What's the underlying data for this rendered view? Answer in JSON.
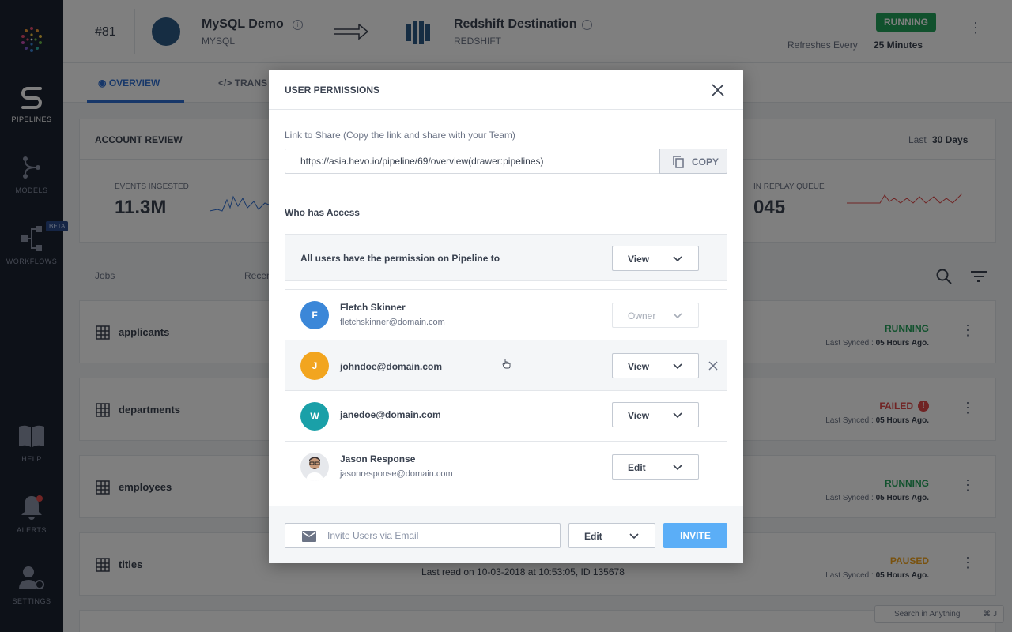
{
  "sidebar": {
    "items": [
      {
        "label": "PIPELINES"
      },
      {
        "label": "MODELS"
      },
      {
        "label": "WORKFLOWS"
      },
      {
        "label": "HELP"
      },
      {
        "label": "ALERTS"
      },
      {
        "label": "SETTINGS"
      }
    ],
    "beta_badge": "BETA"
  },
  "header": {
    "pipeline_number": "#81",
    "source_name": "MySQL Demo",
    "source_type": "MYSQL",
    "destination_name": "Redshift Destination",
    "destination_type": "REDSHIFT",
    "status": "RUNNING",
    "refresh_label": "Refreshes Every",
    "refresh_value": "25 Minutes"
  },
  "tabs": [
    {
      "label": "OVERVIEW"
    },
    {
      "label": "TRANS"
    }
  ],
  "account_review": {
    "title": "ACCOUNT REVIEW",
    "last_label": "Last",
    "last_value": "30 Days",
    "events_label": "EVENTS INGESTED",
    "events_value": "11.3M",
    "replay_label": "IN REPLAY QUEUE",
    "replay_value": "045"
  },
  "jobs": {
    "col_jobs": "Jobs",
    "col_recent": "Recen",
    "rows": [
      {
        "name": "applicants",
        "status": "RUNNING",
        "sync_label": "Last Synced :",
        "sync_value": "05 Hours Ago."
      },
      {
        "name": "departments",
        "status": "FAILED",
        "sync_label": "Last Synced :",
        "sync_value": "05 Hours Ago."
      },
      {
        "name": "employees",
        "status": "RUNNING",
        "sync_label": "Last Synced :",
        "sync_value": "05 Hours Ago."
      },
      {
        "name": "titles",
        "status": "PAUSED",
        "sync_label": "Last Synced :",
        "sync_value": "05 Hours Ago.",
        "extra": "Last read on 10-03-2018 at 10:53:05, ID 135678"
      }
    ]
  },
  "search_anything": {
    "label": "Search in Anything",
    "shortcut": "⌘ J"
  },
  "modal": {
    "title": "USER PERMISSIONS",
    "share_label": "Link to Share (Copy the link and share with your Team)",
    "share_link": "https://asia.hevo.io/pipeline/69/overview(drawer:pipelines)",
    "copy_label": "COPY",
    "access_title": "Who has Access",
    "all_users_label": "All users have the permission on Pipeline to",
    "all_users_permission": "View",
    "users": [
      {
        "initial": "F",
        "name": "Fletch Skinner",
        "email": "fletchskinner@domain.com",
        "permission": "Owner",
        "avatar_color": "#3b87d8"
      },
      {
        "initial": "J",
        "name": "johndoe@domain.com",
        "email": "",
        "permission": "View",
        "avatar_color": "#f2a51f"
      },
      {
        "initial": "W",
        "name": "janedoe@domain.com",
        "email": "",
        "permission": "View",
        "avatar_color": "#1aa0a8"
      },
      {
        "initial": "",
        "name": "Jason Response",
        "email": "jasonresponse@domain.com",
        "permission": "Edit",
        "avatar_color": "#c9ccd2"
      }
    ],
    "invite_placeholder": "Invite Users via Email",
    "invite_permission": "Edit",
    "invite_button": "INVITE"
  }
}
